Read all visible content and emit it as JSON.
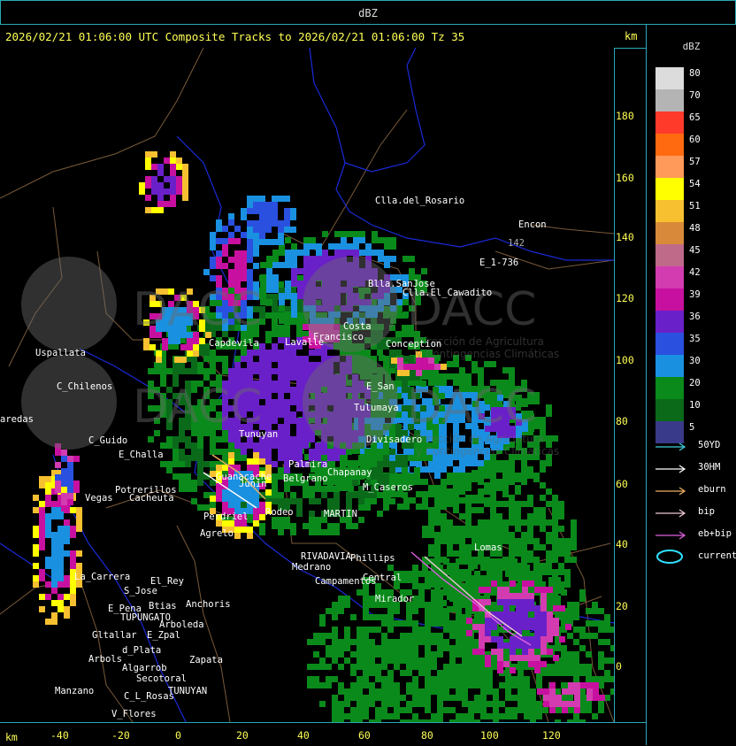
{
  "window": {
    "title": "dBZ"
  },
  "header": {
    "text": "2026/02/21 01:06:00 UTC Composite Tracks to 2026/02/21 01:06:00 Tz 35",
    "unit": "km"
  },
  "axes": {
    "y_ticks": [
      "180",
      "160",
      "140",
      "120",
      "100",
      "80",
      "60",
      "40",
      "20",
      "0"
    ],
    "x_ticks": [
      "-40",
      "-20",
      "0",
      "20",
      "40",
      "60",
      "80",
      "100",
      "120"
    ],
    "x_unit": "km"
  },
  "legend": {
    "title": "dBZ",
    "levels": [
      {
        "label": "80",
        "color": "#dcdcdc"
      },
      {
        "label": "70",
        "color": "#b4b4b4"
      },
      {
        "label": "65",
        "color": "#ff3a2a"
      },
      {
        "label": "60",
        "color": "#ff6a10"
      },
      {
        "label": "57",
        "color": "#ff9a5a"
      },
      {
        "label": "54",
        "color": "#ffff00"
      },
      {
        "label": "51",
        "color": "#f7c030"
      },
      {
        "label": "48",
        "color": "#d88a3a"
      },
      {
        "label": "45",
        "color": "#c06a8a"
      },
      {
        "label": "42",
        "color": "#d23cb0"
      },
      {
        "label": "39",
        "color": "#c810a0"
      },
      {
        "label": "36",
        "color": "#6a20c8"
      },
      {
        "label": "35",
        "color": "#2a50e0"
      },
      {
        "label": "30",
        "color": "#1a90e0"
      },
      {
        "label": "20",
        "color": "#0a8a1a"
      },
      {
        "label": "10",
        "color": "#0a6a1a"
      },
      {
        "label": "5",
        "color": "#3a3a8a"
      }
    ],
    "tracks": [
      {
        "label": "50YD",
        "color": "#40d0e0"
      },
      {
        "label": "30HM",
        "color": "#ffffff"
      },
      {
        "label": "eburn",
        "color": "#f0b060"
      },
      {
        "label": "bip",
        "color": "#f0c8d8"
      },
      {
        "label": "eb+bip",
        "color": "#e060e0"
      },
      {
        "label": "current",
        "color": "#30e0ff"
      }
    ]
  },
  "places": [
    {
      "name": "Clla.del_Rosario",
      "dim": false
    },
    {
      "name": "Encon",
      "dim": false
    },
    {
      "name": "142",
      "dim": true
    },
    {
      "name": "E_1-736",
      "dim": false
    },
    {
      "name": "Blla.SanJose",
      "dim": false
    },
    {
      "name": "Clla.El_Cawadito",
      "dim": false
    },
    {
      "name": "Uspallata",
      "dim": false
    },
    {
      "name": "C_Chilenos",
      "dim": false
    },
    {
      "name": "aredas",
      "dim": false
    },
    {
      "name": "C_Guido",
      "dim": false
    },
    {
      "name": "E_Challa",
      "dim": false
    },
    {
      "name": "Potrerillos",
      "dim": false
    },
    {
      "name": "Vegas",
      "dim": false
    },
    {
      "name": "Cacheuta",
      "dim": false
    },
    {
      "name": "Agrelo",
      "dim": false
    },
    {
      "name": "Perdriel",
      "dim": false
    },
    {
      "name": "La_Carrera",
      "dim": false
    },
    {
      "name": "S_Jose",
      "dim": false
    },
    {
      "name": "E_Pena",
      "dim": false
    },
    {
      "name": "TUPUNGATO",
      "dim": false
    },
    {
      "name": "Anchoris",
      "dim": false
    },
    {
      "name": "Btias",
      "dim": false
    },
    {
      "name": "El_Rey",
      "dim": false
    },
    {
      "name": "Arboleda",
      "dim": false
    },
    {
      "name": "Gltallar",
      "dim": false
    },
    {
      "name": "E_Zpal",
      "dim": false
    },
    {
      "name": "d_Plata",
      "dim": false
    },
    {
      "name": "Arbols",
      "dim": false
    },
    {
      "name": "Algarrob",
      "dim": false
    },
    {
      "name": "Zapata",
      "dim": false
    },
    {
      "name": "Secotoral",
      "dim": false
    },
    {
      "name": "TUNUYAN",
      "dim": false
    },
    {
      "name": "C_L_Rosas",
      "dim": false
    },
    {
      "name": "Manzano",
      "dim": false
    },
    {
      "name": "V_Flores",
      "dim": false
    },
    {
      "name": "Divisadero",
      "dim": false
    },
    {
      "name": "M_Caseros",
      "dim": false
    },
    {
      "name": "Chapanay",
      "dim": false
    },
    {
      "name": "Phillips",
      "dim": false
    },
    {
      "name": "Central",
      "dim": false
    },
    {
      "name": "Mirador",
      "dim": false
    },
    {
      "name": "Campamentos",
      "dim": false
    },
    {
      "name": "Lomas",
      "dim": false
    },
    {
      "name": "MARTIN",
      "dim": false
    },
    {
      "name": "RIVADAVIA",
      "dim": false
    },
    {
      "name": "E_San",
      "dim": false
    },
    {
      "name": "Capdevila",
      "dim": false
    },
    {
      "name": "Lavalle",
      "dim": false
    },
    {
      "name": "Conception",
      "dim": false
    },
    {
      "name": "Tulumaya",
      "dim": false
    },
    {
      "name": "Francisco",
      "dim": false
    },
    {
      "name": "Costa",
      "dim": false
    },
    {
      "name": "Tunuyan",
      "dim": false
    },
    {
      "name": "Junin",
      "dim": false
    },
    {
      "name": "Palmira",
      "dim": false
    },
    {
      "name": "Belgrano",
      "dim": false
    },
    {
      "name": "Rodeo",
      "dim": false
    },
    {
      "name": "Medrano",
      "dim": false
    },
    {
      "name": "Guanacache",
      "dim": false
    }
  ],
  "watermark": {
    "brand": "DACC",
    "line1": "Dirección de Agricultura",
    "line2": "y Contingencias Climáticas"
  }
}
